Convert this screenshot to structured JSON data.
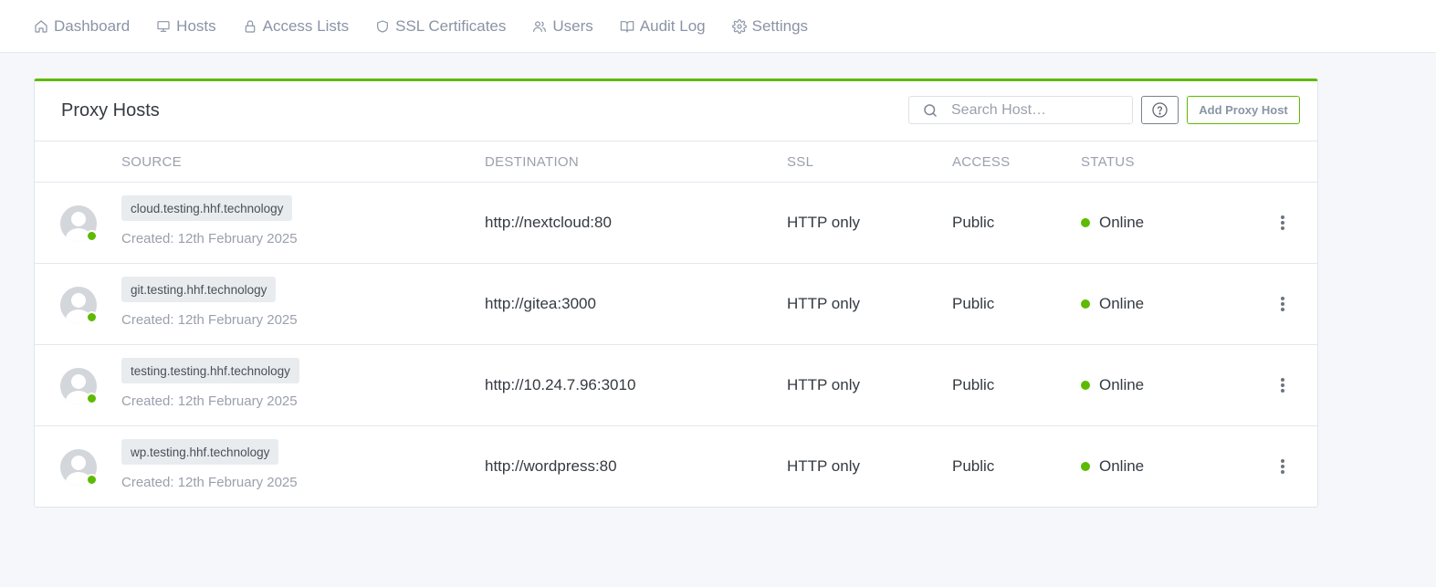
{
  "nav": {
    "items": [
      {
        "label": "Dashboard",
        "icon": "home-icon"
      },
      {
        "label": "Hosts",
        "icon": "monitor-icon"
      },
      {
        "label": "Access Lists",
        "icon": "lock-icon"
      },
      {
        "label": "SSL Certificates",
        "icon": "shield-icon"
      },
      {
        "label": "Users",
        "icon": "users-icon"
      },
      {
        "label": "Audit Log",
        "icon": "book-icon"
      },
      {
        "label": "Settings",
        "icon": "gear-icon"
      }
    ]
  },
  "card": {
    "title": "Proxy Hosts",
    "search_placeholder": "Search Host…",
    "add_button": "Add Proxy Host",
    "accent_color": "#5eba00"
  },
  "table": {
    "headers": {
      "source": "SOURCE",
      "destination": "DESTINATION",
      "ssl": "SSL",
      "access": "ACCESS",
      "status": "STATUS"
    },
    "rows": [
      {
        "domain": "cloud.testing.hhf.technology",
        "created": "Created: 12th February 2025",
        "destination": "http://nextcloud:80",
        "ssl": "HTTP only",
        "access": "Public",
        "status": "Online"
      },
      {
        "domain": "git.testing.hhf.technology",
        "created": "Created: 12th February 2025",
        "destination": "http://gitea:3000",
        "ssl": "HTTP only",
        "access": "Public",
        "status": "Online"
      },
      {
        "domain": "testing.testing.hhf.technology",
        "created": "Created: 12th February 2025",
        "destination": "http://10.24.7.96:3010",
        "ssl": "HTTP only",
        "access": "Public",
        "status": "Online"
      },
      {
        "domain": "wp.testing.hhf.technology",
        "created": "Created: 12th February 2025",
        "destination": "http://wordpress:80",
        "ssl": "HTTP only",
        "access": "Public",
        "status": "Online"
      }
    ]
  }
}
